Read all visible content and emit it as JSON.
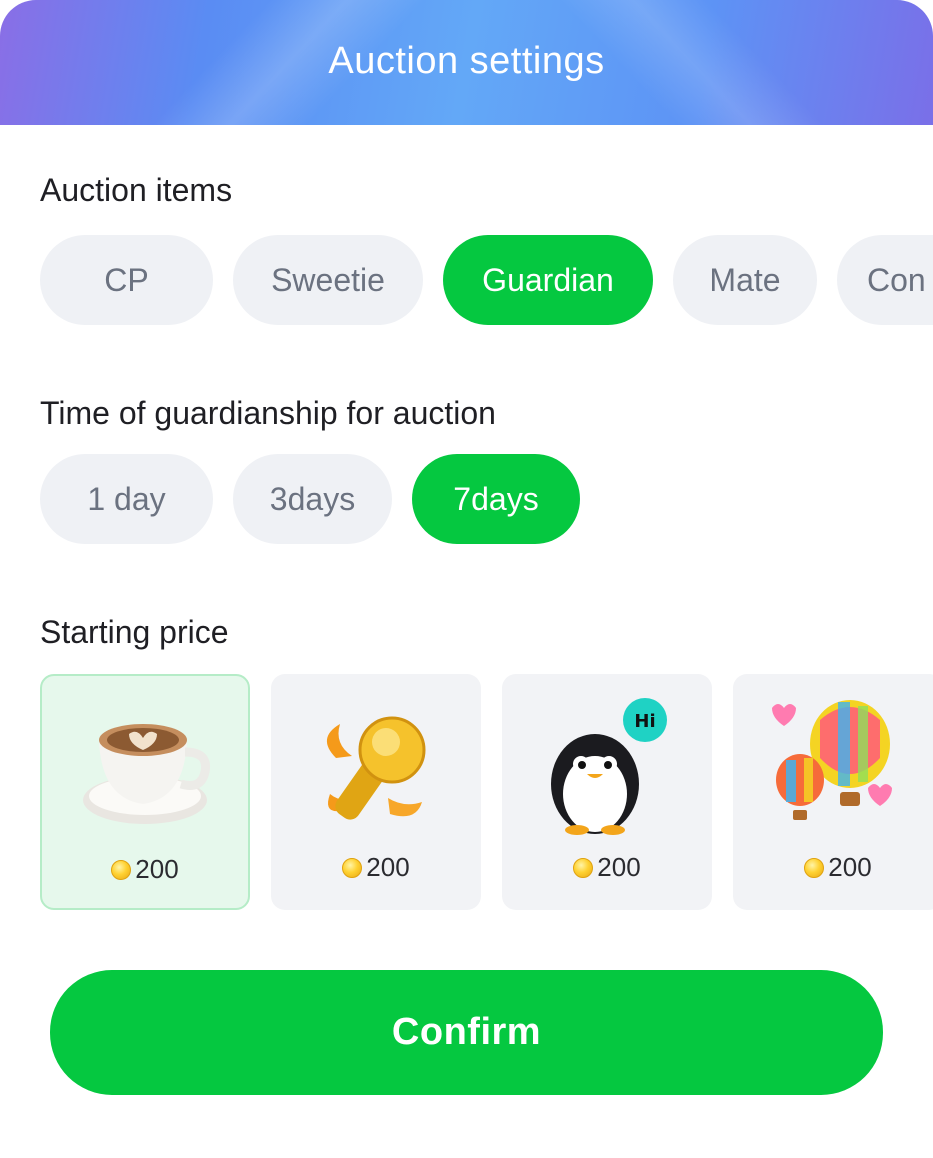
{
  "header": {
    "title": "Auction settings"
  },
  "auction_items": {
    "label": "Auction items",
    "options": [
      "CP",
      "Sweetie",
      "Guardian",
      "Mate",
      "Con"
    ],
    "selected": "Guardian"
  },
  "duration": {
    "label": "Time of guardianship for auction",
    "options": [
      "1 day",
      "3days",
      "7days"
    ],
    "selected": "7days"
  },
  "starting_price": {
    "label": "Starting price",
    "gifts": [
      {
        "icon": "coffee-cup-icon",
        "price": "200",
        "selected": true
      },
      {
        "icon": "golden-microphone-icon",
        "price": "200",
        "selected": false
      },
      {
        "icon": "penguin-hi-icon",
        "price": "200",
        "selected": false
      },
      {
        "icon": "hot-air-balloon-icon",
        "price": "200",
        "selected": false
      }
    ]
  },
  "confirm_label": "Confirm",
  "colors": {
    "accent": "#05c840",
    "chip_bg": "#eff1f5",
    "chip_text": "#6b7280"
  }
}
